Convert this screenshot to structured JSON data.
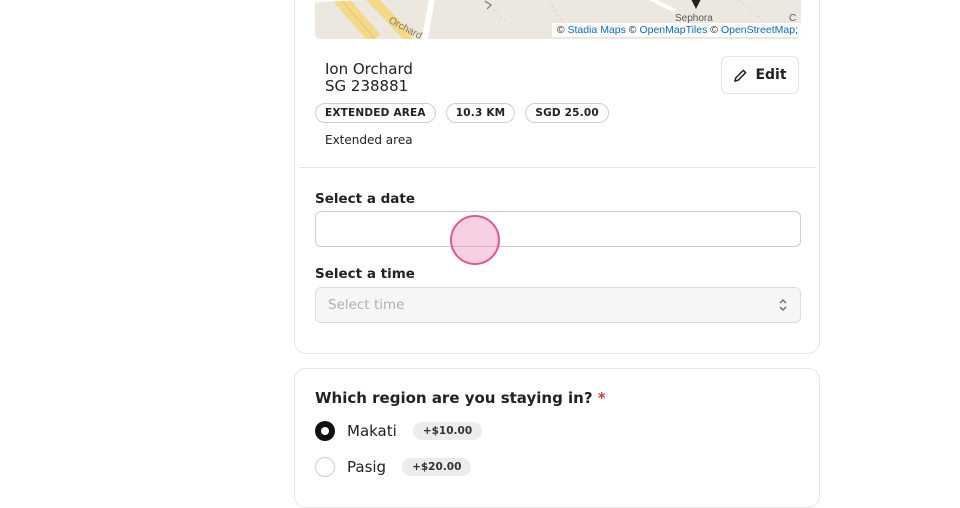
{
  "map": {
    "street_label": "Orchard",
    "poi_label": "Sephora",
    "poi_label_partial": "C",
    "attribution_prefix": "© ",
    "attribution_links": [
      "Stadia Maps",
      "OpenMapTiles",
      "OpenStreetMap"
    ],
    "attribution_sep": " © ",
    "attribution_suffix": ";"
  },
  "location": {
    "name": "Ion Orchard",
    "postal": "SG 238881",
    "edit_label": "Edit",
    "badges": [
      "EXTENDED AREA",
      "10.3 KM",
      "SGD 25.00"
    ],
    "note": "Extended area"
  },
  "schedule": {
    "date_label": "Select a date",
    "date_value": "",
    "time_label": "Select a time",
    "time_placeholder": "Select time"
  },
  "region": {
    "question": "Which region are you staying in?",
    "required_mark": "*",
    "options": [
      {
        "label": "Makati",
        "price": "+$10.00",
        "selected": true
      },
      {
        "label": "Pasig",
        "price": "+$20.00",
        "selected": false
      }
    ]
  }
}
